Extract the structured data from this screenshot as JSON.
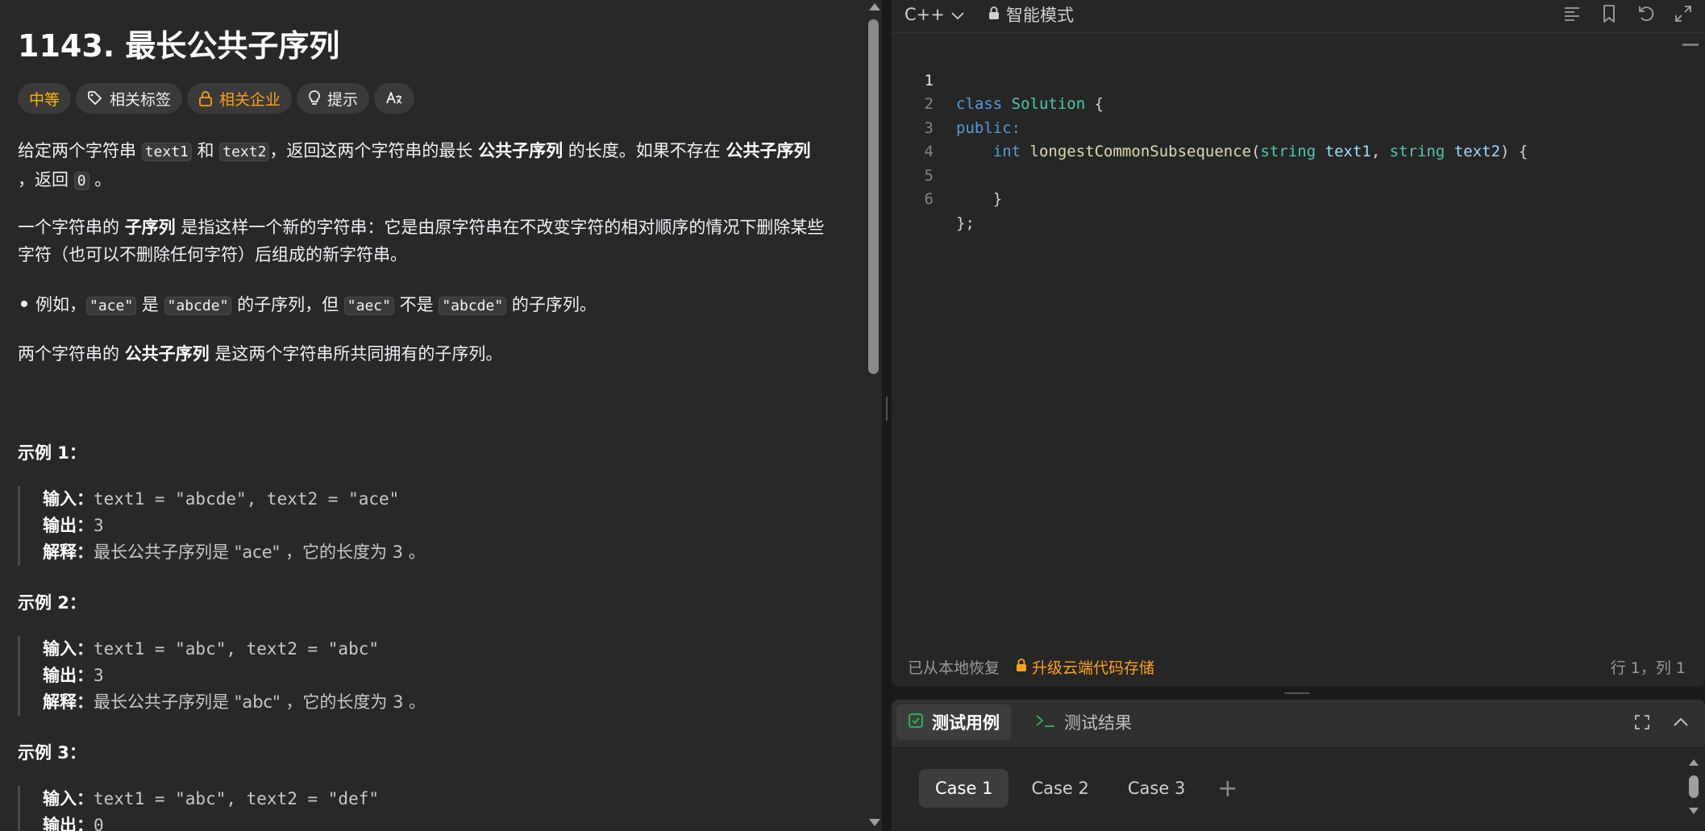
{
  "problem": {
    "title": "1143. 最长公共子序列",
    "tags": {
      "difficulty": "中等",
      "related_tags": "相关标签",
      "related_companies": "相关企业",
      "hint": "提示"
    },
    "para1": {
      "t1": "给定两个字符串 ",
      "c1": "text1",
      "t2": " 和 ",
      "c2": "text2",
      "t3": "，返回这两个字符串的最长 ",
      "b1": "公共子序列",
      "t4": " 的长度。如果不存在 ",
      "b2": "公共子序列",
      "t5": " ，返回 ",
      "c3": "0",
      "t6": " 。"
    },
    "para2": {
      "t1": "一个字符串的 ",
      "b1": "子序列",
      "t2": " 是指这样一个新的字符串：它是由原字符串在不改变字符的相对顺序的情况下删除某些字符（也可以不删除任何字符）后组成的新字符串。"
    },
    "bullet": {
      "t1": "例如，",
      "c1": "\"ace\"",
      "t2": " 是 ",
      "c2": "\"abcde\"",
      "t3": " 的子序列，但 ",
      "c3": "\"aec\"",
      "t4": " 不是 ",
      "c4": "\"abcde\"",
      "t5": " 的子序列。"
    },
    "para3": {
      "t1": "两个字符串的 ",
      "b1": "公共子序列",
      "t2": " 是这两个字符串所共同拥有的子序列。"
    },
    "labels": {
      "input": "输入：",
      "output": "输出：",
      "explain": "解释："
    },
    "examples": [
      {
        "title": "示例 1：",
        "input": "text1 = \"abcde\", text2 = \"ace\"",
        "output": "3",
        "explain": "最长公共子序列是 \"ace\" ，它的长度为 3 。"
      },
      {
        "title": "示例 2：",
        "input": "text1 = \"abc\", text2 = \"abc\"",
        "output": "3",
        "explain": "最长公共子序列是 \"abc\" ，它的长度为 3 。"
      },
      {
        "title": "示例 3：",
        "input": "text1 = \"abc\", text2 = \"def\"",
        "output": "0"
      }
    ]
  },
  "editor": {
    "language": "C++",
    "mode": "智能模式",
    "line_numbers": [
      "1",
      "2",
      "3",
      "4",
      "5",
      "6"
    ],
    "code": {
      "l1_kw": "class",
      "l1_ty": "Solution",
      "l1_rest": " {",
      "l2_kw": "public:",
      "l3_ty": "int",
      "l3_fn": "longestCommonSubsequence",
      "l3_p1": "(",
      "l3_ty2": "string",
      "l3_a1": "text1",
      "l3_sep": ", ",
      "l3_ty3": "string",
      "l3_a2": "text2",
      "l3_end": ") {",
      "l5": "}",
      "l6": "};"
    },
    "status": {
      "restored": "已从本地恢复",
      "upgrade": "升级云端代码存储",
      "cursor": "行 1，列 1"
    }
  },
  "tests": {
    "tab_testcase": "测试用例",
    "tab_result": "测试结果",
    "cases": [
      "Case 1",
      "Case 2",
      "Case 3"
    ],
    "add": "+"
  },
  "colors": {
    "difficulty": "#ffb800",
    "accent": "#ffa116",
    "keyword": "#569cd6",
    "type": "#4ec9b0",
    "function": "#dcdcaa",
    "param": "#9cdcfe"
  }
}
